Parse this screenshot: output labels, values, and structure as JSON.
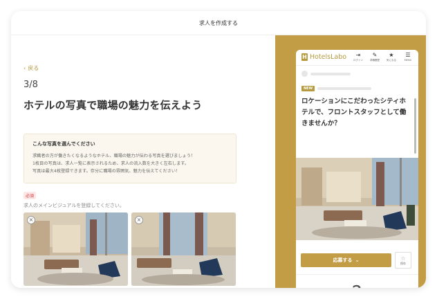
{
  "header": {
    "title": "求人を作成する"
  },
  "form": {
    "back_label": "戻る",
    "step": "3/8",
    "heading": "ホテルの写真で職場の魅力を伝えよう",
    "tip": {
      "title": "こんな写真を選んでください",
      "lines": [
        "求職者の方が働きたくなるようなホテル、職場の魅力が伝わる写真を選びましょう！",
        "1枚目の写真は、求人一覧に表示されるため、求人の流入数を大きく左右します。",
        "写真は最大4枚登録できます。存分に職場の雰囲気、魅力を伝えてください！"
      ]
    },
    "required_badge": "必須",
    "required_text": "求人のメインビジュアルを登録してください。",
    "photo_remove_symbol": "×"
  },
  "preview": {
    "logo_text": "HotelsLabo",
    "nav": [
      {
        "label": "ログイン",
        "icon": "login-icon"
      },
      {
        "label": "求職履歴",
        "icon": "document-icon"
      },
      {
        "label": "気になる",
        "icon": "star-icon"
      },
      {
        "label": "MENU",
        "icon": "menu-icon"
      }
    ],
    "new_badge": "NEW",
    "job_title": "ロケーションにこだわったシティホテルで、フロントスタッフとして働きませんか？",
    "apply_label": "応募する",
    "save_label": "保存"
  },
  "colors": {
    "accent": "#c39d46",
    "accent_text": "#b59a3f",
    "required": "#d23b3b"
  }
}
